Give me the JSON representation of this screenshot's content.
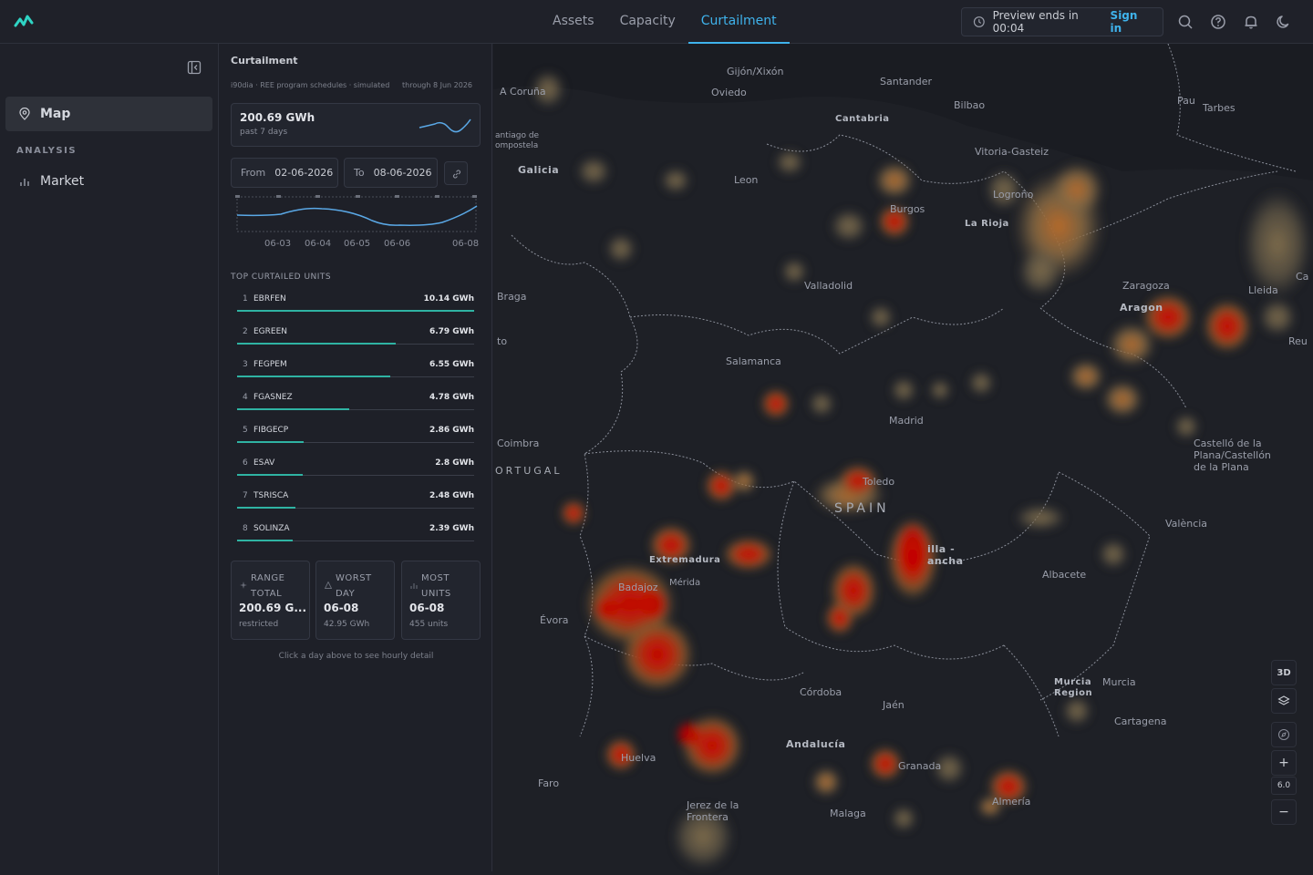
{
  "nav": {
    "tabs": [
      "Assets",
      "Capacity",
      "Curtailment"
    ],
    "active": 2
  },
  "preview": {
    "text": "Preview ends in 00:04",
    "signin": "Sign in"
  },
  "sidebar": {
    "dash": "-",
    "items": [
      {
        "label": "Map",
        "icon": "map-pin-icon"
      }
    ],
    "section": "ANALYSIS",
    "analysis_items": [
      {
        "label": "Market",
        "icon": "bar-chart-icon"
      }
    ]
  },
  "panel": {
    "title": "Curtailment",
    "subtitle": "i90dia · REE program schedules · simulated",
    "through": "through 8 Jun 2026",
    "kpi": {
      "value": "200.69 GWh",
      "label": "past 7 days"
    },
    "from_label": "From",
    "from_value": "02-06-2026",
    "to_label": "To",
    "to_value": "08-06-2026",
    "ticks": [
      "06-03",
      "06-04",
      "06-05",
      "06-06",
      "06-08"
    ],
    "top_header": "TOP CURTAILED UNITS",
    "units": [
      {
        "rank": "1",
        "name": "EBRFEN",
        "gwh": "10.14 GWh",
        "value": 10.14
      },
      {
        "rank": "2",
        "name": "EGREEN",
        "gwh": "6.79 GWh",
        "value": 6.79
      },
      {
        "rank": "3",
        "name": "FEGPEM",
        "gwh": "6.55 GWh",
        "value": 6.55
      },
      {
        "rank": "4",
        "name": "FGASNEZ",
        "gwh": "4.78 GWh",
        "value": 4.78
      },
      {
        "rank": "5",
        "name": "FIBGECP",
        "gwh": "2.86 GWh",
        "value": 2.86
      },
      {
        "rank": "6",
        "name": "ESAV",
        "gwh": "2.8 GWh",
        "value": 2.8
      },
      {
        "rank": "7",
        "name": "TSRISCA",
        "gwh": "2.48 GWh",
        "value": 2.48
      },
      {
        "rank": "8",
        "name": "SOLINZA",
        "gwh": "2.39 GWh",
        "value": 2.39
      }
    ],
    "stats": [
      {
        "l1": "RANGE",
        "l2": "TOTAL",
        "value": "200.69 G...",
        "sub": "restricted"
      },
      {
        "l1": "WORST",
        "l2": "DAY",
        "value": "06-08",
        "sub": "42.95 GWh"
      },
      {
        "l1": "MOST",
        "l2": "UNITS",
        "value": "06-08",
        "sub": "455 units"
      }
    ],
    "hint": "Click a day above to see hourly detail"
  },
  "map": {
    "labels": {
      "gijon": "Gijón/Xixón",
      "oviedo": "Oviedo",
      "santander": "Santander",
      "bilbao": "Bilbao",
      "coruna": "A Coruña",
      "santiago": "antiago de\nompostela",
      "galicia": "Galicia",
      "cantabria": "Cantabria",
      "vitoria": "Vitoria-Gasteiz",
      "pau": "Pau",
      "tarbes": "Tarbes",
      "leon": "Leon",
      "burgos": "Burgos",
      "logrono": "Logroño",
      "larioja": "La Rioja",
      "valladolid": "Valladolid",
      "zaragoza": "Zaragoza",
      "aragon": "Aragon",
      "lleida": "Lleida",
      "ca": "Ca",
      "reu": "Reu",
      "braga": "Braga",
      "to": "to",
      "salamanca": "Salamanca",
      "madrid": "Madrid",
      "coimbra": "Coimbra",
      "portugal": "ORTUGAL",
      "toledo": "Toledo",
      "spain": "SPAIN",
      "castello": "Castelló de la\nPlana/Castellón\nde la Plana",
      "valencia": "València",
      "castilla": "illa -\nancha",
      "extremadura": "Extremadura",
      "badajoz": "Badajoz",
      "merida": "Mérida",
      "evora": "Évora",
      "albacete": "Albacete",
      "murcia_region": "Murcia\nRegion",
      "murcia": "Murcia",
      "cordoba": "Córdoba",
      "jaen": "Jaén",
      "andalucia": "Andalucía",
      "huelva": "Huelva",
      "granada": "Granada",
      "cartagena": "Cartagena",
      "faro": "Faro",
      "jerez": "Jerez de la\nFrontera",
      "malaga": "Malaga",
      "almeria": "Almería"
    },
    "controls": {
      "three_d": "3D",
      "plus": "+",
      "minus": "−",
      "zoom": "6.0"
    }
  }
}
